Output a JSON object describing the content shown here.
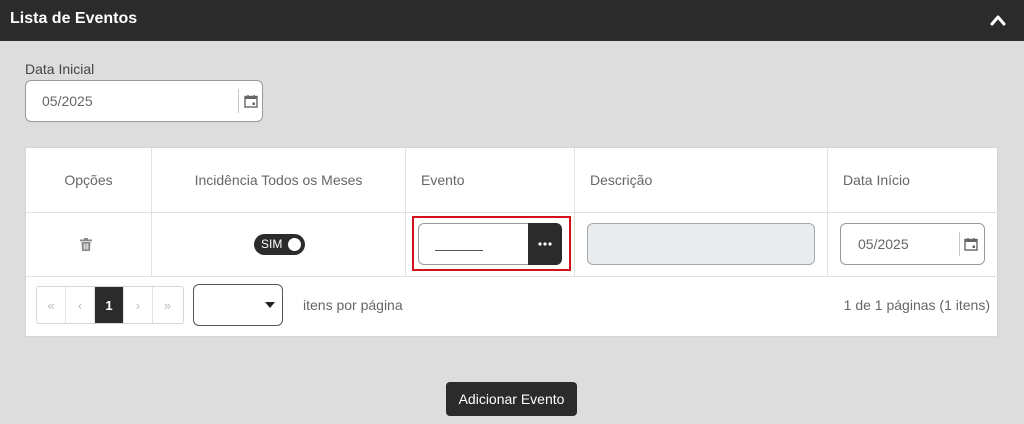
{
  "header": {
    "title": "Lista de Eventos",
    "collapse_icon": "chevron-up-icon"
  },
  "filter": {
    "label": "Data Inicial",
    "value": "05/2025",
    "icon": "calendar-icon"
  },
  "table": {
    "columns": [
      "Opções",
      "Incidência Todos os Meses",
      "Evento",
      "Descrição",
      "Data Início"
    ],
    "rows": [
      {
        "options_icon": "trash-icon",
        "incidencia": "SIM",
        "incidencia_on": true,
        "evento": "",
        "descricao": "",
        "data_inicio": "05/2025"
      }
    ]
  },
  "pagination": {
    "first": "«",
    "prev": "‹",
    "current": "1",
    "next": "›",
    "last": "»",
    "page_size": "",
    "per_page_label": "itens por página",
    "info": "1 de 1 páginas (1 itens)"
  },
  "actions": {
    "add_label": "Adicionar Evento"
  },
  "colors": {
    "dark": "#2b2b2b",
    "highlight": "#d4111a",
    "background": "#dddddd"
  }
}
